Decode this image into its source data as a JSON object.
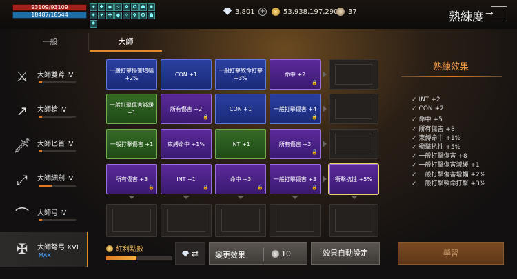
{
  "status": {
    "hp": "93109/93109",
    "mp": "18487/18544"
  },
  "buff_icons": [
    "buff-icon",
    "buff-icon",
    "buff-icon",
    "buff-icon",
    "buff-icon",
    "buff-icon",
    "buff-icon",
    "buff-icon",
    "buff-icon",
    "buff-icon",
    "buff-icon",
    "buff-icon",
    "buff-icon",
    "buff-icon",
    "buff-icon",
    "buff-icon",
    "buff-icon"
  ],
  "currency": {
    "diamond": "3,801",
    "gold": "53,938,197,290",
    "silver": "37"
  },
  "header": {
    "title": "熟練度"
  },
  "tabs": [
    {
      "label": "一般"
    },
    {
      "label": "大師"
    }
  ],
  "sidebar": {
    "items": [
      {
        "label": "大師雙斧 Ⅳ",
        "icon": "double-axe-icon",
        "progress": 0.1
      },
      {
        "label": "大師槍 Ⅳ",
        "icon": "spear-icon",
        "progress": 0.1
      },
      {
        "label": "大師匕首 Ⅳ",
        "icon": "dagger-icon",
        "progress": 0.1
      },
      {
        "label": "大師細劍 Ⅳ",
        "icon": "rapier-icon",
        "progress": 0.35
      },
      {
        "label": "大師弓 Ⅳ",
        "icon": "bow-icon",
        "progress": 0.1
      },
      {
        "label": "大師弩弓 XVI",
        "icon": "crossbow-icon",
        "max": "MAX"
      }
    ]
  },
  "grid": {
    "rows": [
      [
        {
          "color": "blue",
          "label": "一般打擊傷害增幅 +2%"
        },
        {
          "color": "blue",
          "label": "CON +1"
        },
        {
          "color": "blue",
          "label": "一般打擊致命打擊 +3%"
        },
        {
          "color": "purple",
          "label": "命中 +2",
          "locked": true
        },
        {
          "color": "empty",
          "label": ""
        }
      ],
      [
        {
          "color": "green",
          "label": "一般打擊傷害減緩 +1"
        },
        {
          "color": "purple",
          "label": "所有傷害 +2",
          "locked": true
        },
        {
          "color": "blue",
          "label": "CON +1"
        },
        {
          "color": "blue",
          "label": "一般打擊傷害 +4",
          "locked": true
        },
        {
          "color": "empty",
          "label": ""
        }
      ],
      [
        {
          "color": "green",
          "label": "一般打擊傷害 +1"
        },
        {
          "color": "purple",
          "label": "束縛命中 +1%"
        },
        {
          "color": "green",
          "label": "INT +1"
        },
        {
          "color": "purple",
          "label": "所有傷害 +3",
          "locked": true
        },
        {
          "color": "empty",
          "label": ""
        }
      ],
      [
        {
          "color": "purple",
          "label": "所有傷害 +3",
          "locked": true
        },
        {
          "color": "purple",
          "label": "INT +1",
          "locked": true
        },
        {
          "color": "purple",
          "label": "命中 +3",
          "locked": true
        },
        {
          "color": "purple",
          "label": "一般打擊傷害 +3",
          "locked": true
        },
        {
          "color": "purple",
          "label": "衝擊抗性 +5%",
          "selected": true
        }
      ],
      [
        {
          "color": "empty",
          "label": ""
        },
        {
          "color": "empty",
          "label": ""
        },
        {
          "color": "empty",
          "label": ""
        },
        {
          "color": "empty",
          "label": ""
        },
        {
          "color": "empty",
          "label": ""
        }
      ]
    ]
  },
  "effects": {
    "title": "熟練效果",
    "items": [
      "INT +2",
      "CON +2",
      "命中 +5",
      "所有傷害 +8",
      "束縛命中 +1%",
      "衝擊抗性 +5%",
      "一般打擊傷害 +8",
      "一般打擊傷害減緩 +1",
      "一般打擊傷害增幅 +2%",
      "一般打擊致命打擊 +3%"
    ]
  },
  "bottom": {
    "bonus_label": "紅利點數",
    "bonus_progress": 0.46,
    "swap_icon": "⇄",
    "change_label": "變更效果",
    "change_cost": "10",
    "auto_label": "效果自動設定",
    "learn_label": "學習"
  },
  "colors": {
    "accent": "#e07a22",
    "blue": "#2a3fa0",
    "green": "#356b26",
    "purple": "#5b2a9b"
  }
}
